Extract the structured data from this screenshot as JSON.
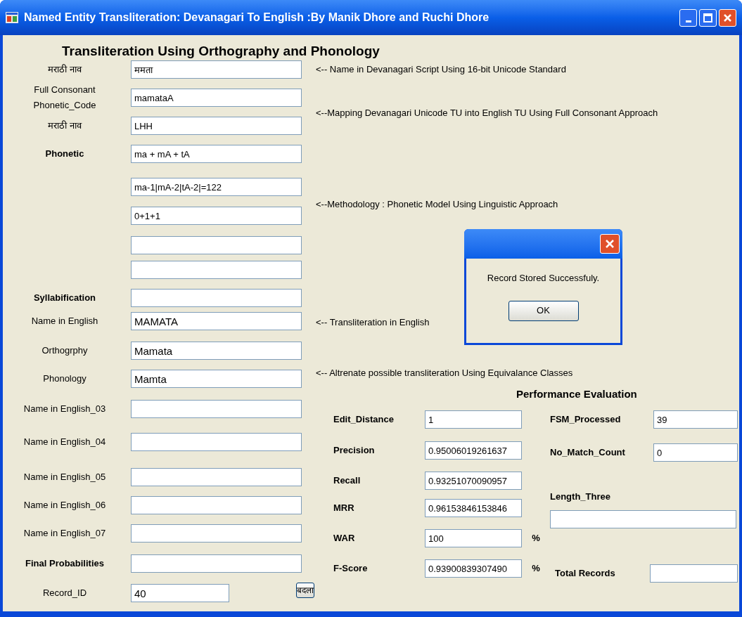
{
  "window": {
    "title": "Named Entity Transliteration: Devanagari  To English :By Manik Dhore and Ruchi Dhore"
  },
  "form": {
    "heading": "Transliteration Using Orthography and Phonology",
    "rows": [
      {
        "label": "मराठी नाव",
        "value": "ममता",
        "bold": false
      },
      {
        "label": "Full Consonant Phonetic_Code",
        "value": "mamataA",
        "bold": false
      },
      {
        "label": "मराठी नाव",
        "value": "LHH",
        "bold": false
      },
      {
        "label": "Phonetic",
        "value": "ma + mA + tA",
        "bold": true
      },
      {
        "value": "ma-1|mA-2|tA-2|=122"
      },
      {
        "value": "0+1+1"
      },
      {},
      {},
      {
        "label": "Syllabification",
        "bold": true
      },
      {
        "label": "Name in English",
        "value": "MAMATA",
        "bold": false
      },
      {
        "label": "Orthogrphy",
        "value": "Mamata",
        "bold": false
      },
      {
        "label": "Phonology",
        "value": "Mamta",
        "bold": false
      },
      {
        "label": "Name in English_03",
        "bold": false
      },
      {
        "label": "Name in English_04",
        "bold": false
      },
      {
        "label": "Name in English_05",
        "bold": false
      },
      {
        "label": "Name in English_06",
        "bold": false
      },
      {
        "label": "Name in English_07",
        "bold": false
      },
      {
        "label": "Final Probabilities",
        "bold": true
      }
    ],
    "record_id": {
      "label": "Record_ID",
      "value": "40"
    },
    "update_button": "बदला"
  },
  "annotations": [
    "<-- Name in Devanagari Script Using 16-bit Unicode Standard",
    "<--Mapping Devanagari Unicode TU into English TU Using Full Consonant Approach",
    "<--Methodology  : Phonetic Model Using Linguistic Approach",
    "<-- Transliteration in English",
    "<-- Altrenate possible transliteration Using Equivalance Classes"
  ],
  "performance": {
    "heading": "Performance Evaluation",
    "metrics": [
      {
        "label": "Edit_Distance",
        "value": "1"
      },
      {
        "label": "Precision",
        "value": "0.95006019261637"
      },
      {
        "label": "Recall",
        "value": "0.93251070090957"
      },
      {
        "label": "MRR",
        "value": "0.96153846153846"
      },
      {
        "label": "WAR",
        "value": "100",
        "unit": "%"
      },
      {
        "label": "F-Score",
        "value": "0.93900839307490",
        "unit": "%"
      }
    ],
    "fsm_processed": {
      "label": "FSM_Processed",
      "value": "39"
    },
    "no_match_count": {
      "label": "No_Match_Count",
      "value": "0"
    },
    "length_three": {
      "label": "Length_Three"
    },
    "total_records": {
      "label": "Total Records"
    }
  },
  "dialog": {
    "message": "Record Stored Successfuly.",
    "button": "OK"
  }
}
